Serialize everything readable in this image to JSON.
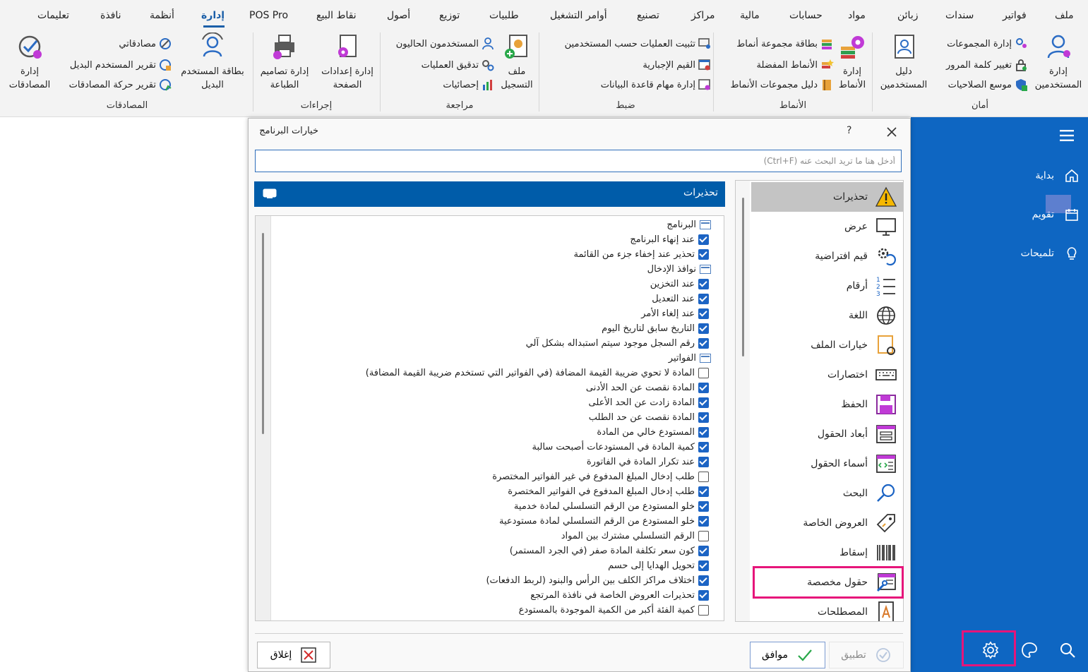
{
  "colors": {
    "accent": "#005ca9",
    "side_panel": "#0e66c2",
    "highlight_frame": "#e6157a",
    "active_tab": "#1b5fa8"
  },
  "menu": {
    "items": [
      "ملف",
      "فواتير",
      "سندات",
      "زبائن",
      "مواد",
      "حسابات",
      "مالية",
      "مراكز",
      "تصنيع",
      "أوامر التشغيل",
      "طلبيات",
      "توزيع",
      "أصول",
      "نقاط البيع",
      "POS Pro",
      "إدارة",
      "أنظمة",
      "نافذة",
      "تعليمات"
    ],
    "active": "إدارة"
  },
  "ribbon": {
    "security": {
      "label": "أمان",
      "manage_users": "إدارة\nالمستخدمين",
      "manage_groups": "إدارة المجموعات",
      "change_password": "تغيير كلمة المرور",
      "permissions_extender": "موسع الصلاحيات",
      "users_guide": "دليل\nالمستخدمين"
    },
    "patterns": {
      "label": "الأنماط",
      "manage_patterns": "إدارة\nالأنماط",
      "pattern_group_card": "بطاقة مجموعة أنماط",
      "favorite_patterns": "الأنماط المفضلة",
      "pattern_groups_guide": "دليل مجموعات الأنماط"
    },
    "control": {
      "label": "ضبط",
      "pin_ops_by_users": "تثبيت العمليات حسب المستخدمين",
      "mandatory_values": "القيم الإجبارية",
      "db_tasks": "إدارة مهام قاعدة البيانات"
    },
    "review": {
      "label": "مراجعة",
      "log_file": "ملف\nالتسجيل",
      "current_users": "المستخدمون الحاليون",
      "audit_ops": "تدقيق العمليات",
      "statistics": "إحصائيات"
    },
    "procedures": {
      "label": "إجراءات",
      "page_setup": "إدارة إعدادات\nالصفحة",
      "print_designs": "إدارة تصاميم\nالطباعة"
    },
    "approvals": {
      "label": "المصادقات",
      "substitute_card": "بطاقة المستخدم\nالبديل",
      "my_approvals": "مصادقاتي",
      "substitute_report": "تقرير المستخدم البديل",
      "approvals_movement_report": "تقرير حركة المصادقات",
      "manage_approvals": "إدارة\nالمصادقات"
    }
  },
  "side_panel": {
    "items": [
      "بداية",
      "تقويم",
      "تلميحات"
    ]
  },
  "dialog": {
    "title": "خيارات البرنامج",
    "help": "?",
    "search_placeholder": "أدخل هنا ما تريد البحث عنه (Ctrl+F)",
    "section_title": "تحذيرات",
    "categories": [
      "تحذيرات",
      "عرض",
      "قيم افتراضية",
      "أرقام",
      "اللغة",
      "خيارات الملف",
      "اختصارات",
      "الحفظ",
      "أبعاد الحقول",
      "أسماء الحقول",
      "البحث",
      "العروض الخاصة",
      "إسقاط",
      "حقول مخصصة",
      "المصطلحات"
    ],
    "selected_category": "تحذيرات",
    "options": [
      {
        "type": "cat",
        "label": "البرنامج"
      },
      {
        "type": "item",
        "label": "عند إنهاء البرنامج",
        "checked": true
      },
      {
        "type": "item",
        "label": "تحذير عند إخفاء جزء من القائمة",
        "checked": true
      },
      {
        "type": "cat",
        "label": "نوافذ الإدخال"
      },
      {
        "type": "item",
        "label": "عند التخزين",
        "checked": true
      },
      {
        "type": "item",
        "label": "عند التعديل",
        "checked": true
      },
      {
        "type": "item",
        "label": "عند إلغاء الأمر",
        "checked": true
      },
      {
        "type": "item",
        "label": "التاريخ سابق لتاريخ اليوم",
        "checked": true
      },
      {
        "type": "item",
        "label": "رقم السجل موجود سيتم استبداله بشكل آلي",
        "checked": true
      },
      {
        "type": "cat",
        "label": "الفواتير"
      },
      {
        "type": "item",
        "label": "المادة لا تحوي ضريبة القيمة المضافة (في الفواتير التي تستخدم ضريبة القيمة المضافة)",
        "checked": false
      },
      {
        "type": "item",
        "label": "المادة نقصت عن الحد الأدنى",
        "checked": true
      },
      {
        "type": "item",
        "label": "المادة زادت عن الحد الأعلى",
        "checked": true
      },
      {
        "type": "item",
        "label": "المادة نقصت عن حد الطلب",
        "checked": true
      },
      {
        "type": "item",
        "label": "المستودع خالي من المادة",
        "checked": true
      },
      {
        "type": "item",
        "label": "كمية المادة في المستودعات أصبحت سالبة",
        "checked": true
      },
      {
        "type": "item",
        "label": "عند تكرار المادة في الفاتورة",
        "checked": true
      },
      {
        "type": "item",
        "label": "طلب إدخال المبلغ المدفوع في غير الفواتير المختصرة",
        "checked": false
      },
      {
        "type": "item",
        "label": "طلب إدخال المبلغ المدفوع في الفواتير المختصرة",
        "checked": true
      },
      {
        "type": "item",
        "label": "خلو المستودع من الرقم التسلسلي لمادة خدمية",
        "checked": true
      },
      {
        "type": "item",
        "label": "خلو المستودع من الرقم التسلسلي لمادة مستودعية",
        "checked": true
      },
      {
        "type": "item",
        "label": "الرقم التسلسلي مشترك بين المواد",
        "checked": false
      },
      {
        "type": "item",
        "label": "كون سعر تكلفة المادة صفر (في الجرد المستمر)",
        "checked": true
      },
      {
        "type": "item",
        "label": "تحويل الهدايا إلى حسم",
        "checked": true
      },
      {
        "type": "item",
        "label": "اختلاف مراكز الكلف بين الرأس والبنود (لربط الدفعات)",
        "checked": true
      },
      {
        "type": "item",
        "label": "تحذيرات العروض الخاصة في نافذة المرتجع",
        "checked": true
      },
      {
        "type": "item",
        "label": "كمية الفئة أكبر من الكمية الموجودة بالمستودع",
        "checked": false
      }
    ],
    "buttons": {
      "close": "إغلاق",
      "ok": "موافق",
      "apply": "تطبيق"
    }
  }
}
